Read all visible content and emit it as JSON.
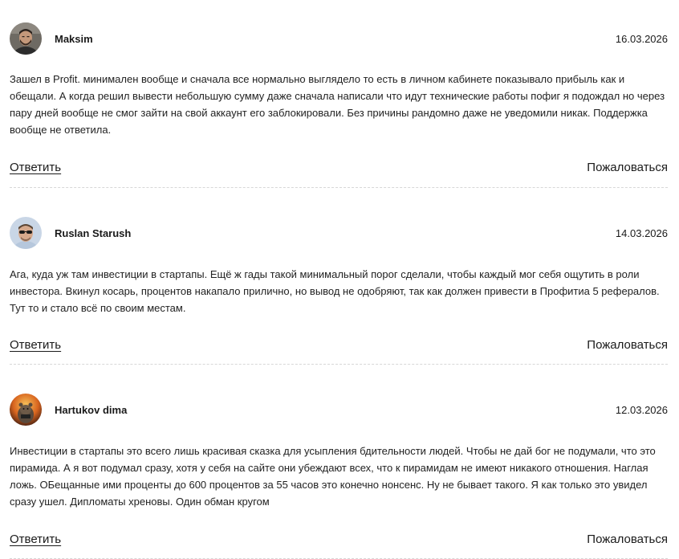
{
  "comments": [
    {
      "author": "Maksim",
      "date": "16.03.2026",
      "avatar": "avatar-photo-man-beard",
      "text": "Зашел в Profit. минимален вообще и сначала все нормально выглядело то есть в личном кабинете показывало прибыль как и обещали. А когда решил вывести небольшую сумму даже сначала написали что идут технические работы пофиг я подождал но через пару дней вообще не смог зайти на свой аккаунт его заблокировали. Без причины рандомно даже не уведомили никак. Поддержка вообще не ответила.",
      "reply_label": "Ответить",
      "complain_label": "Пожаловаться"
    },
    {
      "author": "Ruslan Starush",
      "date": "14.03.2026",
      "avatar": "avatar-photo-man-sunglasses",
      "text": "Ага, куда уж там инвестиции в стартапы. Ещё ж гады такой минимальный порог сделали, чтобы каждый мог себя ощутить в роли инвестора. Вкинул косарь, процентов накапало прилично, но вывод не одобряют, так как должен привести в Профитиа 5 рефералов. Тут то и стало всё по своим местам.",
      "reply_label": "Ответить",
      "complain_label": "Пожаловаться"
    },
    {
      "author": "Hartukov dima",
      "date": "12.03.2026",
      "avatar": "avatar-picture-animal-fire",
      "text": "Инвестиции в стартапы это всего лишь красивая сказка для усыпления бдительности людей. Чтобы не дай бог не подумали, что это пирамида. А я вот подумал сразу, хотя у себя на сайте они убеждают всех, что к пирамидам не имеют никакого отношения. Наглая ложь. ОБещанные ими проценты до 600 процентов за 55 часов это конечно нонсенс. Ну не бывает такого. Я как только это увидел сразу ушел. Дипломаты хреновы. Один обман кругом",
      "reply_label": "Ответить",
      "complain_label": "Пожаловаться"
    }
  ]
}
